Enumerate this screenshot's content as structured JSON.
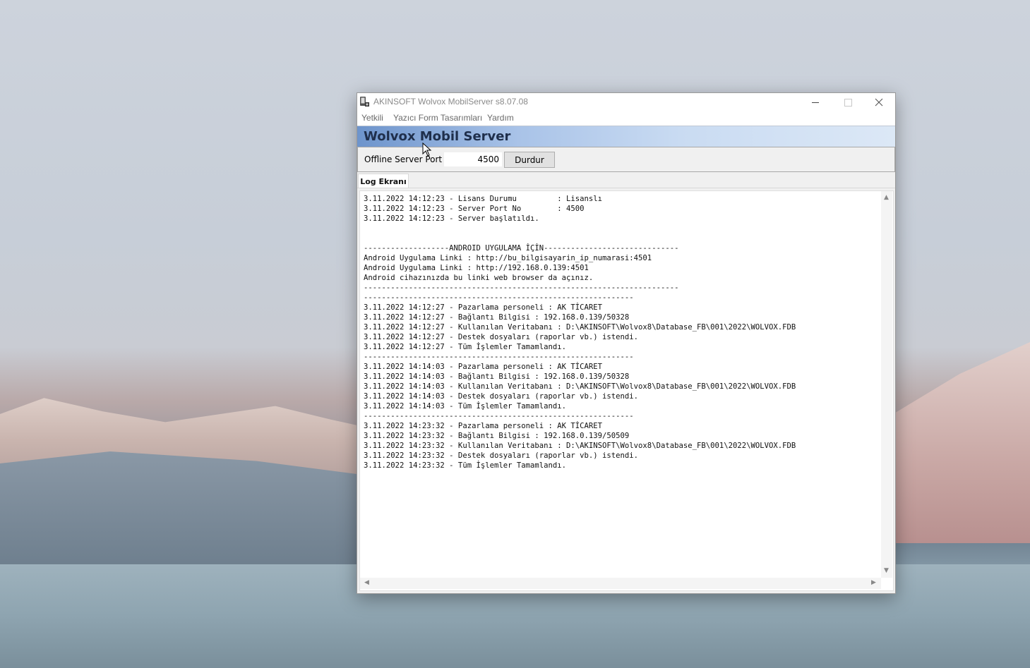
{
  "window": {
    "title": "AKINSOFT Wolvox MobilServer s8.07.08",
    "icons": [
      "app-icon",
      "minimize-icon",
      "maximize-icon",
      "close-icon"
    ]
  },
  "menu": {
    "items": [
      "Yetkili",
      "Yazıcı Form Tasarımları",
      "Yardım"
    ]
  },
  "banner": {
    "title": "Wolvox Mobil Server"
  },
  "toolbar": {
    "port_label": "Offline Server Port",
    "port_value": "4500",
    "stop_label": "Durdur"
  },
  "tabs": {
    "log_label": "Log Ekranı"
  },
  "log": {
    "lines": [
      "3.11.2022 14:12:23 - Lisans Durumu         : Lisanslı",
      "3.11.2022 14:12:23 - Server Port No        : 4500",
      "3.11.2022 14:12:23 - Server başlatıldı.",
      "",
      "",
      "-------------------ANDROID UYGULAMA İÇİN------------------------------",
      "Android Uygulama Linki : http://bu_bilgisayarin_ip_numarasi:4501",
      "Android Uygulama Linki : http://192.168.0.139:4501",
      "Android cihazınızda bu linki web browser da açınız.",
      "----------------------------------------------------------------------",
      "------------------------------------------------------------",
      "3.11.2022 14:12:27 - Pazarlama personeli : AK TİCARET",
      "3.11.2022 14:12:27 - Bağlantı Bilgisi : 192.168.0.139/50328",
      "3.11.2022 14:12:27 - Kullanılan Veritabanı : D:\\AKINSOFT\\Wolvox8\\Database_FB\\001\\2022\\WOLVOX.FDB",
      "3.11.2022 14:12:27 - Destek dosyaları (raporlar vb.) istendi.",
      "3.11.2022 14:12:27 - Tüm İşlemler Tamamlandı.",
      "------------------------------------------------------------",
      "3.11.2022 14:14:03 - Pazarlama personeli : AK TİCARET",
      "3.11.2022 14:14:03 - Bağlantı Bilgisi : 192.168.0.139/50328",
      "3.11.2022 14:14:03 - Kullanılan Veritabanı : D:\\AKINSOFT\\Wolvox8\\Database_FB\\001\\2022\\WOLVOX.FDB",
      "3.11.2022 14:14:03 - Destek dosyaları (raporlar vb.) istendi.",
      "3.11.2022 14:14:03 - Tüm İşlemler Tamamlandı.",
      "------------------------------------------------------------",
      "3.11.2022 14:23:32 - Pazarlama personeli : AK TİCARET",
      "3.11.2022 14:23:32 - Bağlantı Bilgisi : 192.168.0.139/50509",
      "3.11.2022 14:23:32 - Kullanılan Veritabanı : D:\\AKINSOFT\\Wolvox8\\Database_FB\\001\\2022\\WOLVOX.FDB",
      "3.11.2022 14:23:32 - Destek dosyaları (raporlar vb.) istendi.",
      "3.11.2022 14:23:32 - Tüm İşlemler Tamamlandı."
    ]
  }
}
